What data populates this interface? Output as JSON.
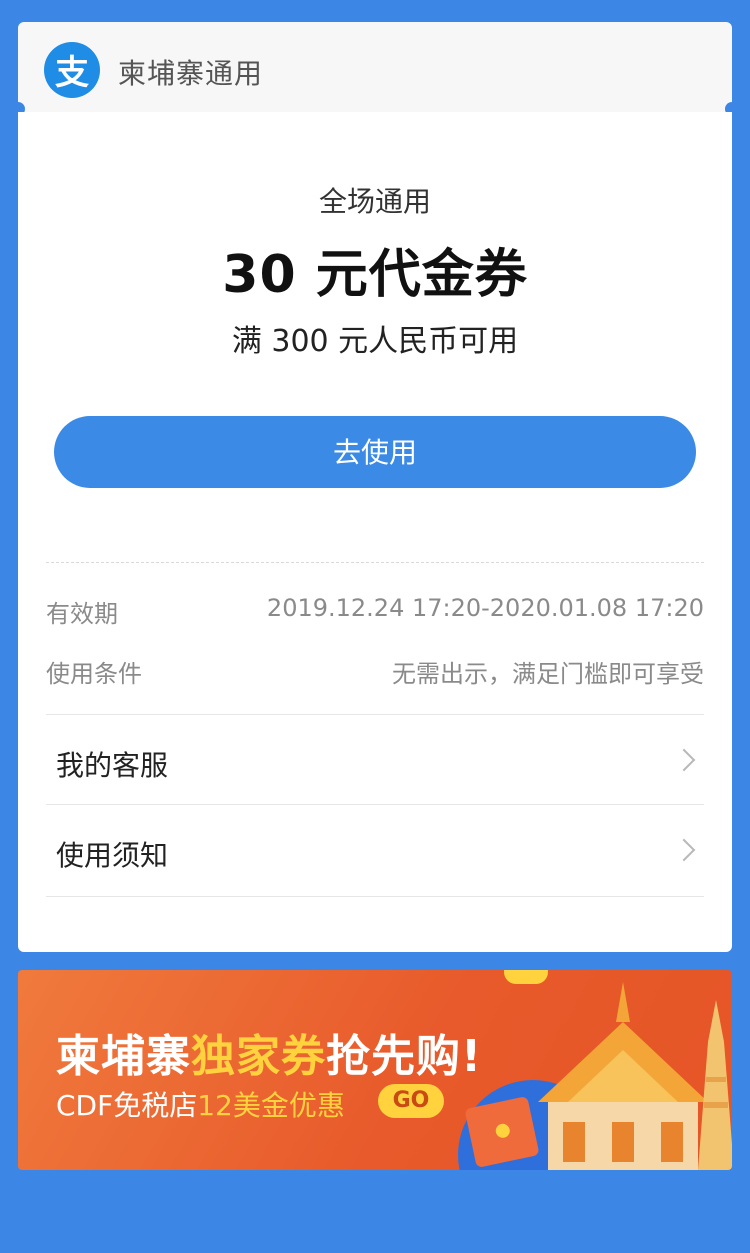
{
  "header": {
    "logo_glyph": "支",
    "brand": "柬埔寨通用"
  },
  "voucher": {
    "scope": "全场通用",
    "title": "30 元代金券",
    "condition": "满 300 元人民币可用",
    "use_button": "去使用"
  },
  "details": {
    "validity_label": "有效期",
    "validity_value": "2019.12.24 17:20-2020.01.08 17:20",
    "terms_label": "使用条件",
    "terms_value": "无需出示，满足门槛即可享受"
  },
  "links": [
    {
      "label": "我的客服"
    },
    {
      "label": "使用须知"
    }
  ],
  "banner": {
    "headline_part1": "柬埔寨",
    "headline_part2": "独家券",
    "headline_part3": "抢先购!",
    "sub_part1": "CDF免税店",
    "sub_part2": "12美金优惠",
    "go": "GO"
  },
  "colors": {
    "page_bg": "#3c87e6",
    "button": "#3a8ae6",
    "banner_orange": "#e85a2b",
    "banner_highlight": "#ffd23e"
  }
}
